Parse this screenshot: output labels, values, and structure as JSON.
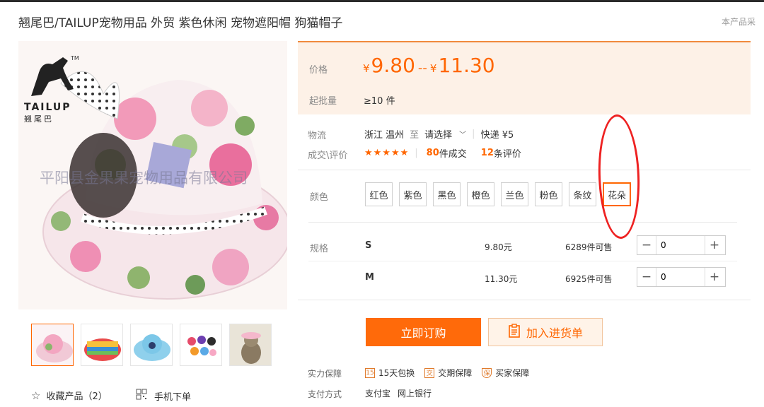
{
  "product": {
    "title": "翘尾巴/TAILUP宠物用品 外贸 紫色休闲 宠物遮阳帽 狗猫帽子",
    "corner_text": "本产品采"
  },
  "brand": {
    "logo_text": "TAILUP",
    "logo_sub": "翘尾巴",
    "tm": "TM"
  },
  "watermark": "平阳县金果果宠物用品有限公司",
  "gallery": {
    "thumbnails": [
      "thumb-pink-floral-hat",
      "thumb-rainbow-hat",
      "thumb-blue-hat",
      "thumb-hat-collection",
      "thumb-cat-wearing-hat"
    ]
  },
  "actions_left": {
    "favorite_label": "收藏产品（2）",
    "mobile_order_label": "手机下单"
  },
  "price": {
    "label": "价格",
    "currency": "¥",
    "low": "9.80",
    "range_sep": "--",
    "high": "11.30",
    "min_order_label": "起批量",
    "min_order_value": "≥10 件"
  },
  "logistics": {
    "label": "物流",
    "origin": "浙江 温州",
    "to": "至",
    "destination_select": "请选择",
    "express": "快递 ¥5"
  },
  "deals": {
    "label": "成交\\评价",
    "stars": "★★★★★",
    "sold_count": "80",
    "sold_suffix": "件成交",
    "review_count": "12",
    "review_suffix": "条评价"
  },
  "color": {
    "label": "颜色",
    "options": [
      "红色",
      "紫色",
      "黑色",
      "橙色",
      "兰色",
      "粉色",
      "条纹",
      "花朵"
    ],
    "selected": "花朵"
  },
  "spec": {
    "label": "规格",
    "rows": [
      {
        "size": "S",
        "price": "9.80元",
        "stock": "6289件可售",
        "qty": "0"
      },
      {
        "size": "M",
        "price": "11.30元",
        "stock": "6925件可售",
        "qty": "0"
      }
    ]
  },
  "buttons": {
    "buy_now": "立即订购",
    "add_to_list": "加入进货单"
  },
  "guarantee": {
    "label": "实力保障",
    "items": [
      "15天包换",
      "交期保障",
      "买家保障"
    ],
    "icons": [
      "15",
      "交",
      "保"
    ]
  },
  "payment": {
    "label": "支付方式",
    "methods": [
      "支付宝",
      "网上银行"
    ]
  },
  "colors": {
    "accent": "#ff6600",
    "price_bg": "#fdf1e7",
    "annotation_red": "#ee2222"
  }
}
